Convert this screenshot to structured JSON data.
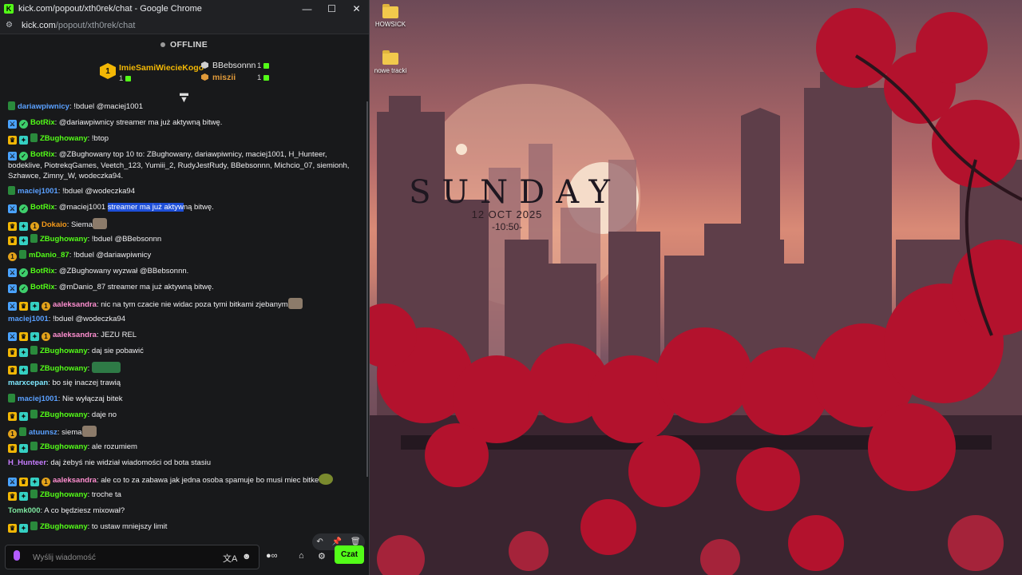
{
  "window": {
    "title": "kick.com/popout/xth0rek/chat - Google Chrome",
    "minimize_icon": "minimize-icon",
    "maximize_icon": "maximize-icon",
    "close_icon": "close-icon",
    "minimize": "—",
    "maximize": "☐",
    "close": "✕"
  },
  "address": {
    "host": "kick.com",
    "path": "/popout/xth0rek/chat",
    "site_icon": "⚙"
  },
  "stream_status": "OFFLINE",
  "leaderboard": {
    "first": {
      "rank": "1",
      "name": "ImieSamiWiecieKogo",
      "count": "1",
      "color": "#f2b705"
    },
    "second": {
      "name": "BBebsonnn",
      "count": "1",
      "color": "#cfcfcf"
    },
    "third": {
      "name": "miszii",
      "count": "1",
      "color": "#e09a3a"
    }
  },
  "colors": {
    "accent": "#53fc18",
    "bot_name": "#53fc18",
    "mod_badge": "#4aa3ff"
  },
  "messages": [
    {
      "badges": [
        "sub"
      ],
      "user": "dariawpiwnicy",
      "color": "#5aa0ff",
      "text": "!bduel @maciej1001"
    },
    {
      "badges": [
        "mod",
        "bot"
      ],
      "user": "BotRix",
      "color": "#53fc18",
      "text": "@dariawpiwnicy streamer ma już aktywną bitwę."
    },
    {
      "badges": [
        "vip",
        "og",
        "sub"
      ],
      "user": "ZBughowany",
      "color": "#53fc18",
      "text": "!btop"
    },
    {
      "badges": [
        "mod",
        "bot"
      ],
      "user": "BotRix",
      "color": "#53fc18",
      "text": "@ZBughowany top 10 to: ZBughowany, dariawpiwnicy, maciej1001, H_Hunteer, bodeklive, PiotrekqGames, Veetch_123, Yumiii_2, RudyJestRudy, BBebsonnn, Michcio_07, siemionh, Szhawce, Zimny_W, wodeczka94."
    },
    {
      "badges": [
        "sub"
      ],
      "user": "maciej1001",
      "color": "#5aa0ff",
      "text": "!bduel @wodeczka94"
    },
    {
      "badges": [
        "mod",
        "bot"
      ],
      "user": "BotRix",
      "color": "#53fc18",
      "text_pre": "@maciej1001 ",
      "text_sel": "streamer ma już aktyw",
      "text_post": "ną bitwę."
    },
    {
      "badges": [
        "vip",
        "og",
        "tier"
      ],
      "user": "Dokaio",
      "color": "#f59a1a",
      "text": "Siema"
    },
    {
      "badges": [
        "vip",
        "og",
        "sub"
      ],
      "user": "ZBughowany",
      "color": "#53fc18",
      "text": "!bduel @BBebsonnn"
    },
    {
      "badges": [
        "tier",
        "sub"
      ],
      "user": "mDanio_87",
      "color": "#53fc18",
      "text": "!bduel @dariawpiwnicy"
    },
    {
      "badges": [
        "mod",
        "bot"
      ],
      "user": "BotRix",
      "color": "#53fc18",
      "text": "@ZBughowany wyzwał @BBebsonnn."
    },
    {
      "badges": [
        "mod",
        "bot"
      ],
      "user": "BotRix",
      "color": "#53fc18",
      "text": "@mDanio_87 streamer ma już aktywną bitwę."
    },
    {
      "badges": [
        "mod",
        "vip",
        "og",
        "tier"
      ],
      "user": "aaleksandra",
      "color": "#ff8fd0",
      "text": "nic na tym czacie nie widac poza tymi bitkami zjebanym"
    },
    {
      "badges": [],
      "user": "maciej1001",
      "color": "#5aa0ff",
      "text": "!bduel @wodeczka94"
    },
    {
      "badges": [
        "mod",
        "vip",
        "og",
        "tier"
      ],
      "user": "aaleksandra",
      "color": "#ff8fd0",
      "text": "JEZU REL"
    },
    {
      "badges": [
        "vip",
        "og",
        "sub"
      ],
      "user": "ZBughowany",
      "color": "#53fc18",
      "text": "daj sie pobawić"
    },
    {
      "badges": [
        "vip",
        "og",
        "sub"
      ],
      "user": "ZBughowany",
      "color": "#53fc18",
      "text": ""
    },
    {
      "badges": [],
      "user": "marxcepan",
      "color": "#7ee8ff",
      "text": "bo się inaczej trawią"
    },
    {
      "badges": [
        "sub"
      ],
      "user": "maciej1001",
      "color": "#5aa0ff",
      "text": "Nie wyłączaj bitek"
    },
    {
      "badges": [
        "vip",
        "og",
        "sub"
      ],
      "user": "ZBughowany",
      "color": "#53fc18",
      "text": "daje no"
    },
    {
      "badges": [
        "tier",
        "sub"
      ],
      "user": "atuunsz",
      "color": "#5aa0ff",
      "text": "siema"
    },
    {
      "badges": [
        "vip",
        "og",
        "sub"
      ],
      "user": "ZBughowany",
      "color": "#53fc18",
      "text": "ale rozumiem"
    },
    {
      "badges": [],
      "user": "H_Hunteer",
      "color": "#c77dff",
      "text": "daj żebyś nie widział wiadomości od bota stasiu"
    },
    {
      "badges": [
        "mod",
        "vip",
        "og",
        "tier"
      ],
      "user": "aaleksandra",
      "color": "#ff8fd0",
      "text": "ale co to za zabawa jak jedna osoba spamuje bo musi miec bitke"
    },
    {
      "badges": [
        "vip",
        "og",
        "sub"
      ],
      "user": "ZBughowany",
      "color": "#53fc18",
      "text": "troche ta"
    },
    {
      "badges": [],
      "user": "Tomk000",
      "color": "#7ee8a0",
      "text": "A co będziesz mixował?"
    },
    {
      "badges": [
        "vip",
        "og",
        "sub"
      ],
      "user": "ZBughowany",
      "color": "#53fc18",
      "text": "to ustaw mniejszy limit"
    }
  ],
  "composer": {
    "placeholder": "Wyślij wiadomość",
    "send_label": "Czat"
  },
  "desktop": {
    "icons": [
      {
        "label": "HOWSICK"
      },
      {
        "label": "nowe tracki"
      }
    ],
    "widget": {
      "day": "SUNDAY",
      "date": "12 OCT 2025",
      "time": "-10:50-"
    }
  }
}
